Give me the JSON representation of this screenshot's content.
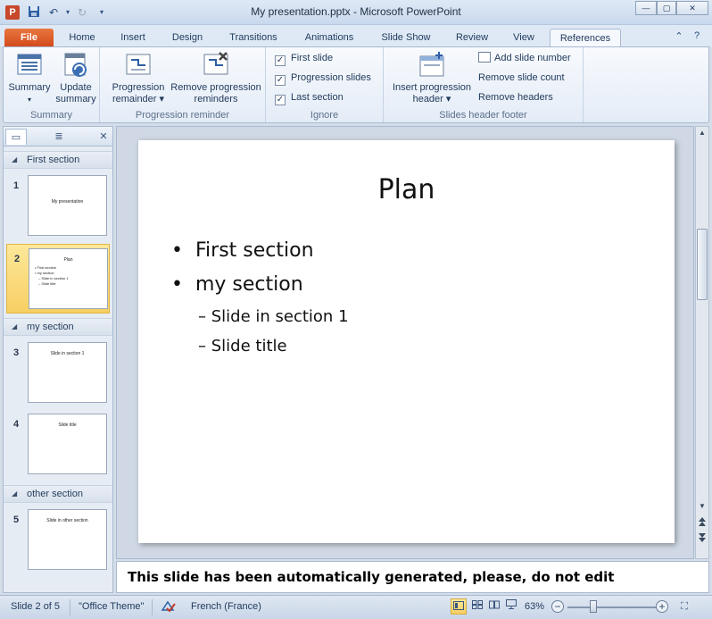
{
  "window": {
    "title": "My presentation.pptx - Microsoft PowerPoint",
    "app_letter": "P",
    "controls": {
      "minimize": "—",
      "maximize": "▢",
      "close": "✕"
    }
  },
  "qat": {
    "save_icon": "💾",
    "undo_icon": "↶",
    "redo_icon": "↻",
    "dropdown_icon": "▾"
  },
  "tabs": [
    {
      "label": "File"
    },
    {
      "label": "Home"
    },
    {
      "label": "Insert"
    },
    {
      "label": "Design"
    },
    {
      "label": "Transitions"
    },
    {
      "label": "Animations"
    },
    {
      "label": "Slide Show"
    },
    {
      "label": "Review"
    },
    {
      "label": "View"
    },
    {
      "label": "References"
    }
  ],
  "ribbon": {
    "summary_group": {
      "label": "Summary",
      "summary_btn": {
        "line1": "Summary",
        "arrow": "▾"
      },
      "update_btn": {
        "line1": "Update",
        "line2": "summary"
      }
    },
    "progression_group": {
      "label": "Progression reminder",
      "reminder_btn": {
        "line1": "Progression",
        "line2": "remainder ▾"
      },
      "remove_btn": {
        "line1": "Remove progression",
        "line2": "reminders"
      }
    },
    "ignore_group": {
      "label": "Ignore",
      "first_slide": "First slide",
      "progression_slides": "Progression slides",
      "last_section": "Last section",
      "check": "✓"
    },
    "header_group": {
      "label": "Slides header  footer",
      "insert_btn": {
        "line1": "Insert progression",
        "line2": "header ▾"
      },
      "add_number": "Add slide number",
      "remove_count": "Remove slide count",
      "remove_headers": "Remove headers"
    }
  },
  "left_panel": {
    "tab_slides_icon": "▭",
    "tab_outline_icon": "≣",
    "close_icon": "✕",
    "sections": [
      {
        "name": "First section"
      },
      {
        "name": "my section"
      },
      {
        "name": "other section"
      }
    ],
    "slides": [
      {
        "num": "1",
        "title": "My presentation"
      },
      {
        "num": "2",
        "title": "Plan"
      },
      {
        "num": "3",
        "title": "Slide in section 1"
      },
      {
        "num": "4",
        "title": "Slide title"
      },
      {
        "num": "5",
        "title": "Slide in other section"
      }
    ],
    "collapse_icon": "◢"
  },
  "slide": {
    "title": "Plan",
    "bullets": [
      "First section",
      "my section"
    ],
    "subbullets": [
      "Slide in section 1",
      "Slide title"
    ],
    "bullet_char": "•",
    "dash_char": "–"
  },
  "scrollbar": {
    "up": "▲",
    "down": "▼",
    "prev": "⯭",
    "next": "⯯"
  },
  "notes": {
    "text": "This slide has been automatically generated, please, do not edit"
  },
  "status": {
    "slide_count": "Slide 2 of 5",
    "theme": "\"Office Theme\"",
    "language": "French (France)",
    "zoom": "63%",
    "zoom_minus": "−",
    "zoom_plus": "+",
    "fit_icon": "⛶"
  },
  "colors": {
    "file_tab": "#d34a1c",
    "selected_thumb": "#f7cf62",
    "ribbon_text": "#1e395b"
  }
}
